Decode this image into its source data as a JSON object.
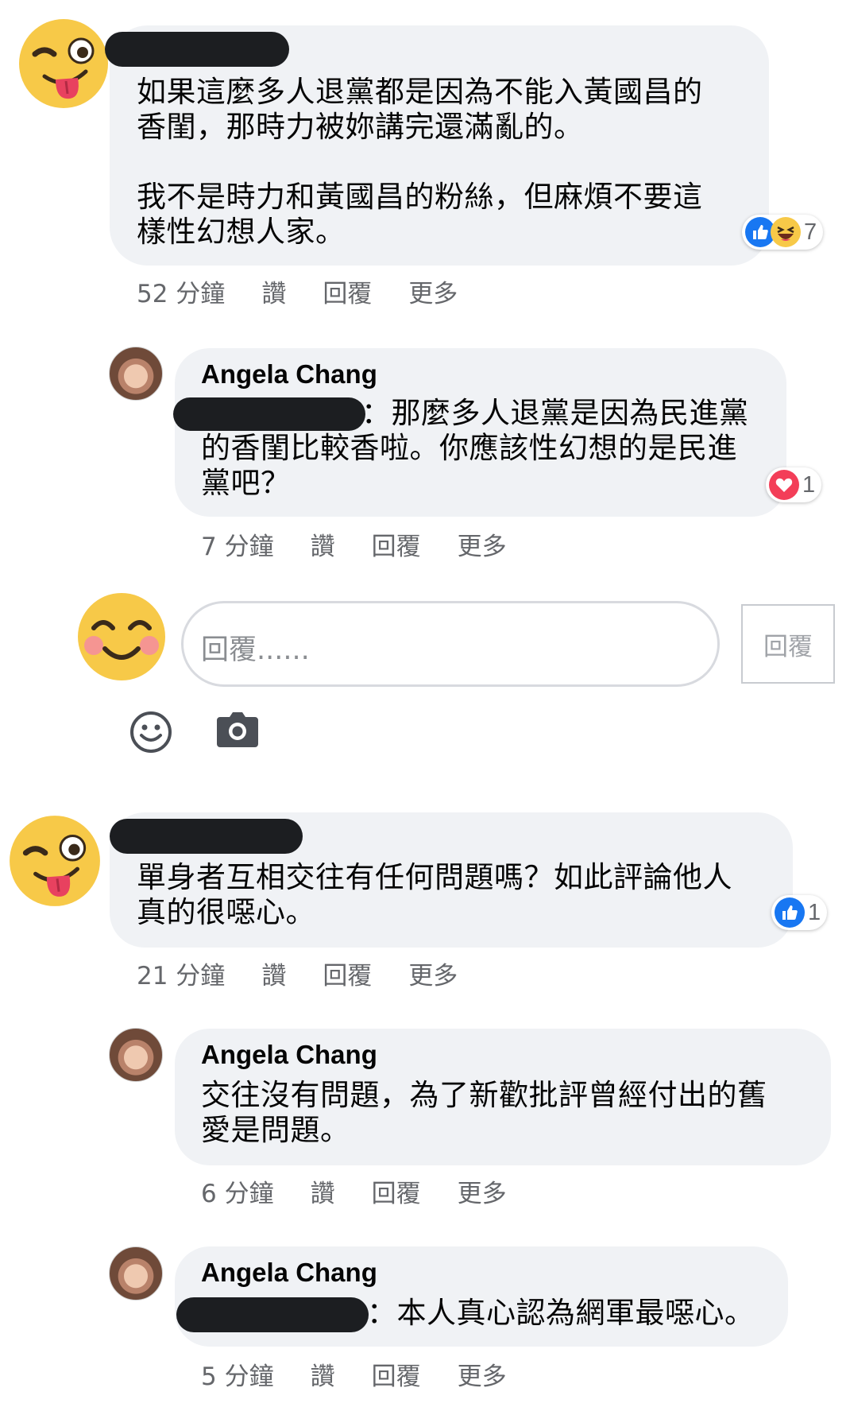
{
  "thread": {
    "comment1": {
      "text": "如果這麼多人退黨都是因為不能入黃國昌的\n香閨，那時力被妳講完還滿亂的。\n\n我不是時力和黃國昌的粉絲，但麻煩不要這\n樣性幻想人家。",
      "reaction_count": "7",
      "meta": {
        "time": "52 分鐘",
        "like": "讚",
        "reply": "回覆",
        "more": "更多"
      },
      "reply1": {
        "author": "Angela Chang",
        "text_line1": "：那麼多人退黨是因為民進黨",
        "text_rest": "的香閨比較香啦。你應該性幻想的是民進\n黨吧？",
        "reaction_count": "1",
        "meta": {
          "time": "7 分鐘",
          "like": "讚",
          "reply": "回覆",
          "more": "更多"
        }
      }
    },
    "composer": {
      "placeholder": "回覆......",
      "submit_label": "回覆"
    },
    "comment2": {
      "text": "單身者互相交往有任何問題嗎？如此評論他人\n真的很噁心。",
      "reaction_count": "1",
      "meta": {
        "time": "21 分鐘",
        "like": "讚",
        "reply": "回覆",
        "more": "更多"
      },
      "reply1": {
        "author": "Angela Chang",
        "text": "交往沒有問題，為了新歡批評曾經付出的舊\n愛是問題。",
        "meta": {
          "time": "6 分鐘",
          "like": "讚",
          "reply": "回覆",
          "more": "更多"
        }
      },
      "reply2": {
        "author": "Angela Chang",
        "text_line1": "：本人真心認為網軍最噁心。",
        "meta": {
          "time": "5 分鐘",
          "like": "讚",
          "reply": "回覆",
          "more": "更多"
        }
      }
    }
  },
  "colors": {
    "bubble": "#f0f2f5",
    "meta_text": "#65676b",
    "like_blue": "#1877f2",
    "love_red": "#f33e58",
    "emoji_yellow": "#f7c948",
    "redaction": "#1c1e21"
  },
  "icons": [
    "winking-tongue-emoji-avatar",
    "smiling-blush-emoji-avatar",
    "like-icon",
    "haha-icon",
    "love-icon",
    "smiley-icon",
    "camera-icon"
  ]
}
